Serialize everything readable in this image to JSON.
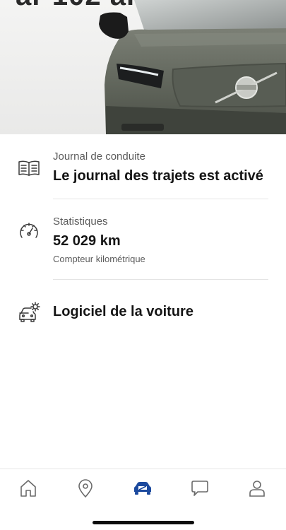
{
  "hero": {
    "partial_title": "ar 102 ar"
  },
  "rows": [
    {
      "label": "Journal de conduite",
      "value": "Le journal des trajets est activé",
      "icon": "book-icon"
    },
    {
      "label": "Statistiques",
      "value": "52 029 km",
      "sub": "Compteur kilométrique",
      "icon": "speedometer-icon"
    },
    {
      "value": "Logiciel de la voiture",
      "icon": "car-settings-icon"
    }
  ],
  "tabs": [
    {
      "name": "home",
      "icon": "home-icon"
    },
    {
      "name": "map",
      "icon": "location-pin-icon"
    },
    {
      "name": "car",
      "icon": "car-icon",
      "active": true
    },
    {
      "name": "messages",
      "icon": "chat-bubble-icon"
    },
    {
      "name": "profile",
      "icon": "person-icon"
    }
  ],
  "colors": {
    "active_tab": "#1c4a9e",
    "car_body": "#5f645b",
    "text_primary": "#151515",
    "text_secondary": "#5b5b5b"
  }
}
